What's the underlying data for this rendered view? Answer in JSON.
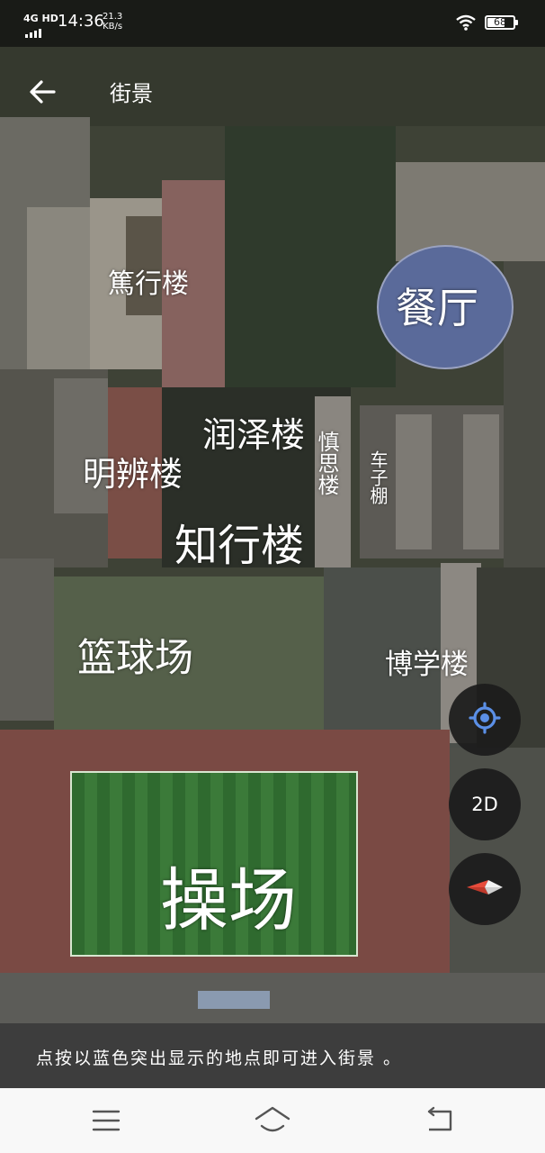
{
  "status_bar": {
    "network": "4G HD",
    "time": "14:36",
    "speed_value": "21.3",
    "speed_unit": "KB/s",
    "battery": "68"
  },
  "header": {
    "back_icon": "arrow-left-icon",
    "street_view_label": "街景"
  },
  "map": {
    "places": [
      {
        "name": "篤行楼"
      },
      {
        "name": "餐厅"
      },
      {
        "name": "润泽楼"
      },
      {
        "name": "慎思楼"
      },
      {
        "name": "明辨楼"
      },
      {
        "name": "车子棚"
      },
      {
        "name": "知行楼"
      },
      {
        "name": "篮球场"
      },
      {
        "name": "博学楼"
      },
      {
        "name": "操场"
      }
    ]
  },
  "controls": {
    "locate_icon": "crosshair-icon",
    "mode_label": "2D",
    "compass_icon": "compass-icon"
  },
  "tip": {
    "text": "点按以蓝色突出显示的地点即可进入街景 。"
  },
  "nav_bar": {
    "menu_icon": "menu-icon",
    "home_icon": "home-icon",
    "back_icon": "back-icon"
  },
  "colors": {
    "canteen_blue": "#5a6a9a",
    "field_green": "#2f6a2f",
    "track_red": "#7a4a44",
    "tip_bar": "#3d3d3d",
    "fab": "#1c1c1c"
  }
}
